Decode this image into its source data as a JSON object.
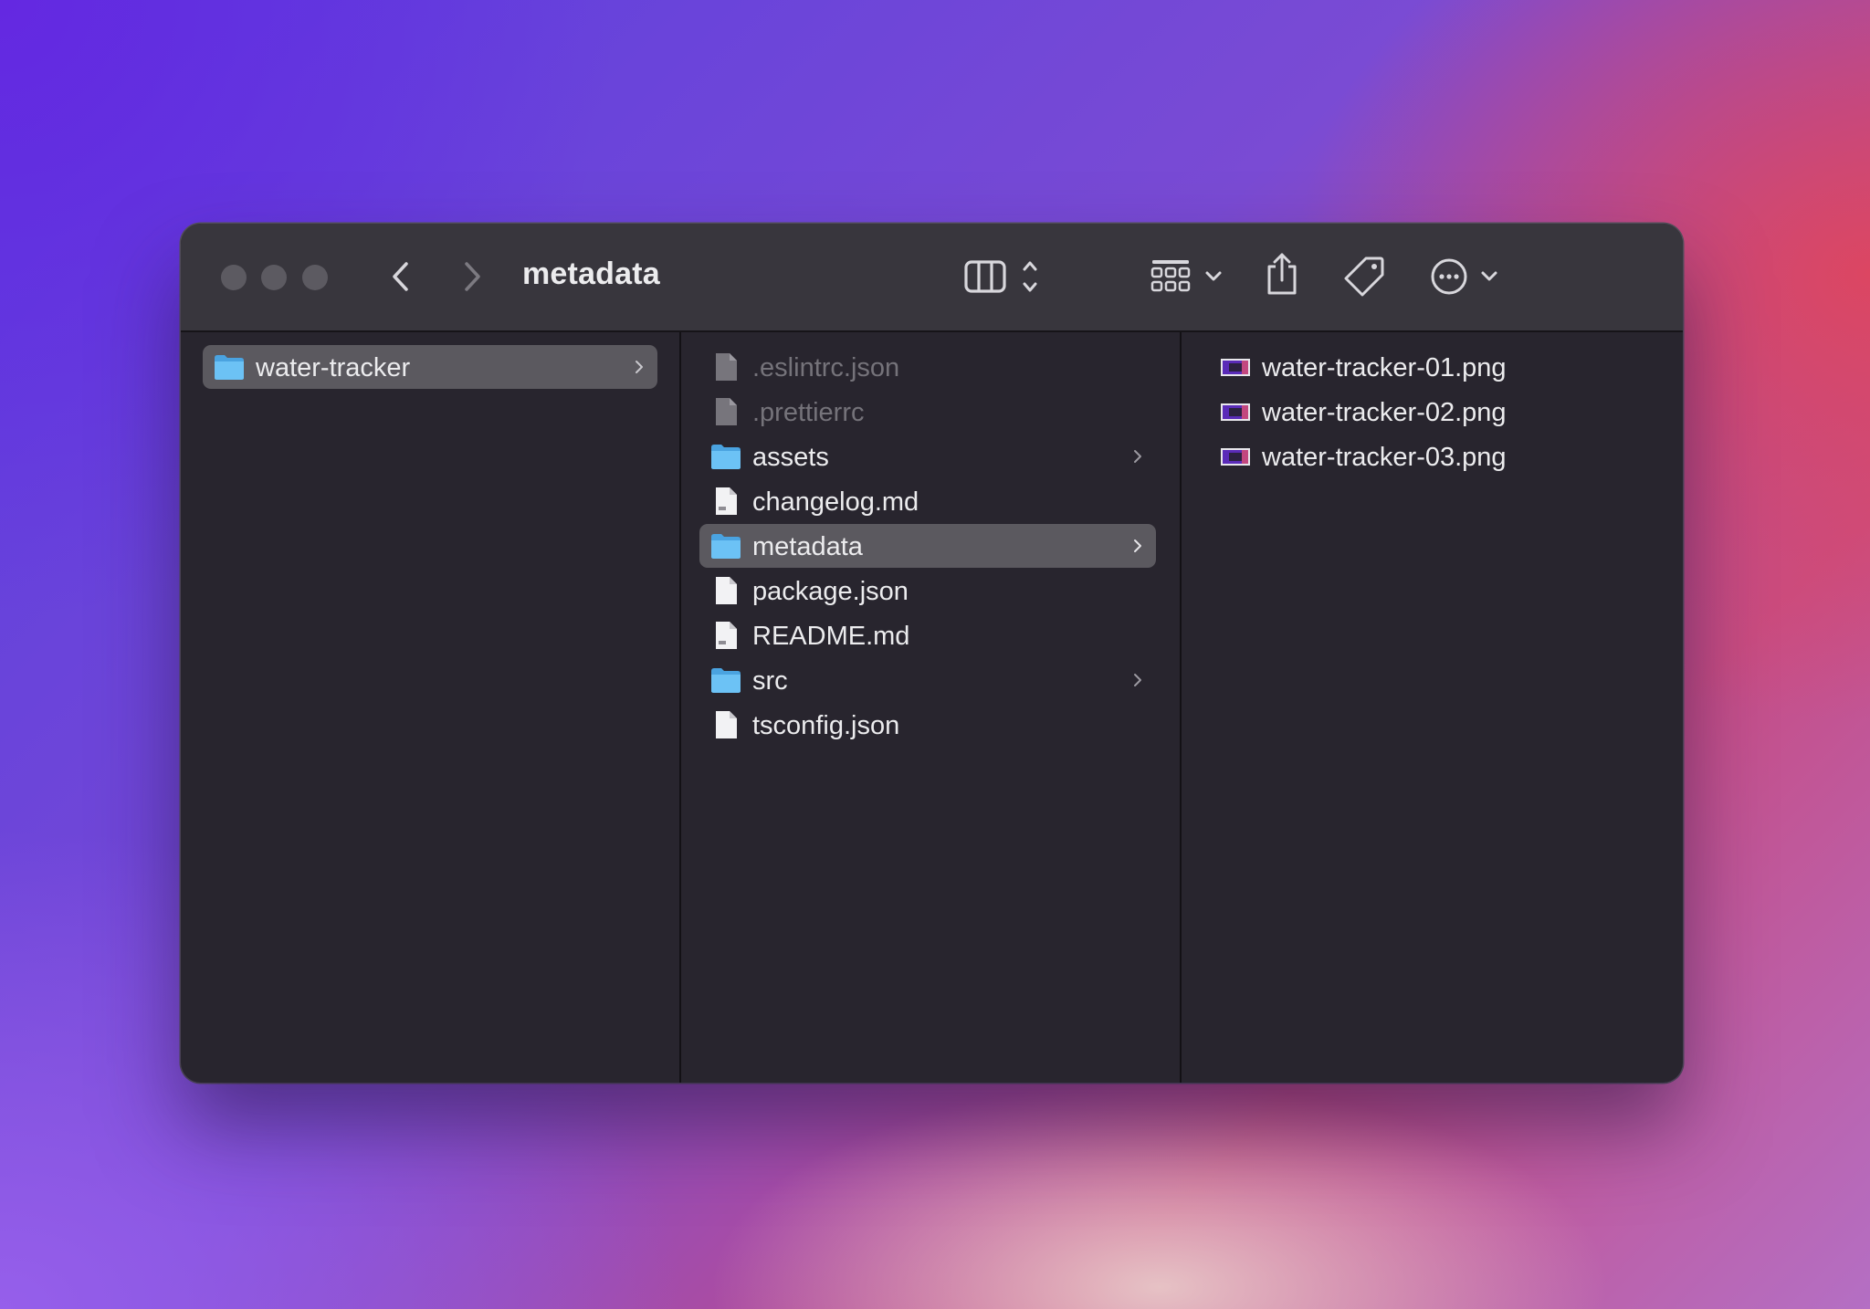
{
  "window": {
    "title": "metadata"
  },
  "toolbar": {
    "buttons": [
      {
        "name": "back-icon"
      },
      {
        "name": "forward-icon"
      },
      {
        "name": "view-columns-icon"
      },
      {
        "name": "group-icon"
      },
      {
        "name": "share-icon"
      },
      {
        "name": "tag-icon"
      },
      {
        "name": "more-actions-icon"
      },
      {
        "name": "search-icon"
      }
    ]
  },
  "columns": {
    "col1": [
      {
        "label": "water-tracker",
        "type": "folder",
        "selected": true,
        "has_children": true
      }
    ],
    "col2": [
      {
        "label": ".eslintrc.json",
        "type": "file",
        "hidden": true
      },
      {
        "label": ".prettierrc",
        "type": "file",
        "hidden": true
      },
      {
        "label": "assets",
        "type": "folder",
        "has_children": true
      },
      {
        "label": "changelog.md",
        "type": "md-file"
      },
      {
        "label": "metadata",
        "type": "folder",
        "selected": true,
        "has_children": true
      },
      {
        "label": "package.json",
        "type": "file"
      },
      {
        "label": "README.md",
        "type": "md-file"
      },
      {
        "label": "src",
        "type": "folder",
        "has_children": true
      },
      {
        "label": "tsconfig.json",
        "type": "file"
      }
    ],
    "col3": [
      {
        "label": "water-tracker-01.png",
        "type": "image"
      },
      {
        "label": "water-tracker-02.png",
        "type": "image"
      },
      {
        "label": "water-tracker-03.png",
        "type": "image"
      }
    ]
  },
  "colors": {
    "folder": "#5fb8f0",
    "selection": "#5b595f",
    "window_bg": "#28252e",
    "titlebar_bg": "#38363d"
  }
}
